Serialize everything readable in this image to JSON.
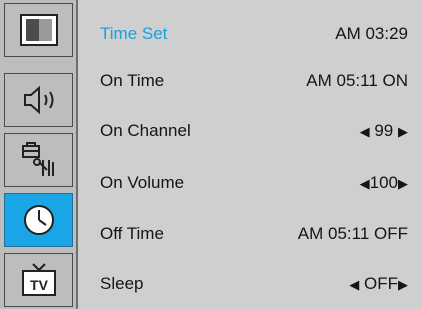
{
  "sidebar": {
    "items": [
      {
        "name": "picture",
        "icon": "picture-icon",
        "active": false
      },
      {
        "name": "sound",
        "icon": "speaker-icon",
        "active": false
      },
      {
        "name": "setup",
        "icon": "tools-icon",
        "active": false
      },
      {
        "name": "time",
        "icon": "clock-icon",
        "active": true
      },
      {
        "name": "tv",
        "icon": "tv-icon",
        "active": false
      }
    ]
  },
  "menu": {
    "items": [
      {
        "label": "Time Set",
        "value": "AM 03:29",
        "selected": true
      },
      {
        "label": "On Time",
        "value": "AM 05:11 ON",
        "selected": false
      },
      {
        "label": "On Channel",
        "left_arrow": "◀",
        "value": "99",
        "right_arrow": "▶",
        "selected": false
      },
      {
        "label": "On Volume",
        "left_arrow": "◀",
        "value": "100",
        "right_arrow": "▶",
        "selected": false
      },
      {
        "label": "Off Time",
        "value": "AM 05:11 OFF",
        "selected": false
      },
      {
        "label": "Sleep",
        "left_arrow": "◀",
        "value": "OFF",
        "right_arrow": "▶",
        "selected": false
      }
    ]
  },
  "colors": {
    "accent": "#1aa6e6",
    "selected_text": "#1aa0e0",
    "rail_bg": "#bdbdbd",
    "pane_bg": "#cfcfcf"
  }
}
